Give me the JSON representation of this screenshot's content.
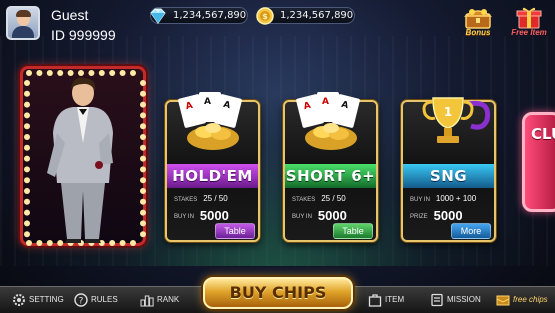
{
  "user": {
    "name": "Guest",
    "id_label": "ID 999999"
  },
  "currency": {
    "diamonds": "1,234,567,890",
    "coins": "1,234,567,890"
  },
  "top_actions": {
    "bonus_label": "Bonus",
    "free_item_label": "Free Item"
  },
  "club": {
    "label": "CLUB"
  },
  "games": [
    {
      "title": "HOLD'EM",
      "row1_label": "STAKES",
      "row1_value": "25 / 50",
      "row2_label": "BUY IN",
      "row2_value": "5000",
      "button": "Table"
    },
    {
      "title": "SHORT 6+",
      "row1_label": "STAKES",
      "row1_value": "25 / 50",
      "row2_label": "BUY IN",
      "row2_value": "5000",
      "button": "Table"
    },
    {
      "title": "SNG",
      "row1_label": "BUY IN",
      "row1_value": "1000 + 100",
      "row2_label": "PRIZE",
      "row2_value": "5000",
      "button": "More"
    }
  ],
  "bottom_nav": {
    "setting": "SETTING",
    "rules": "RULES",
    "rank": "RANK",
    "buy_chips": "BUY CHIPS",
    "item": "ITEM",
    "mission": "MISSION",
    "free_chips": "free chips"
  },
  "colors": {
    "holdem": "#8a2fb0",
    "short": "#1f8a3a",
    "sng": "#1d6fa8",
    "gold_border": "#e8c56a",
    "club": "#d82a5a"
  },
  "icons": [
    "diamond-icon",
    "gold-coin-icon",
    "bonus-chest-icon",
    "gift-box-icon",
    "gear-icon",
    "question-icon",
    "rank-icon",
    "item-icon",
    "mission-icon",
    "free-chips-icon",
    "trophy-icon",
    "cards-icon"
  ]
}
